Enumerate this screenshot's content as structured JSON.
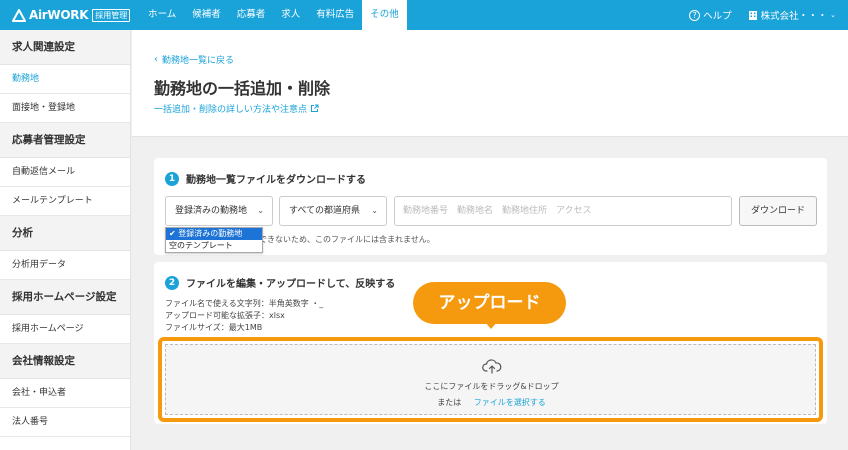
{
  "header": {
    "brand": "AirWORK",
    "badge": "採用管理",
    "nav": [
      "ホーム",
      "候補者",
      "応募者",
      "求人",
      "有料広告",
      "その他"
    ],
    "help": "ヘルプ",
    "company": "株式会社・・・",
    "accent": "#1aa3d9"
  },
  "sidebar": {
    "sec1_title": "求人関連設定",
    "sec1_items": [
      "勤務地",
      "面接地・登録地"
    ],
    "sec2_title": "応募者管理設定",
    "sec2_items": [
      "自動返信メール",
      "メールテンプレート"
    ],
    "sec3_title": "分析",
    "sec3_items": [
      "分析用データ"
    ],
    "sec4_title": "採用ホームページ設定",
    "sec4_items": [
      "採用ホームページ"
    ],
    "sec5_title": "会社情報設定",
    "sec5_items": [
      "会社・申込者",
      "法人番号"
    ]
  },
  "page": {
    "back": "勤務地一覧に戻る",
    "title": "勤務地の一括追加・削除",
    "detail": "一括追加・削除の詳しい方法や注意点"
  },
  "step1": {
    "num": "1",
    "title": "勤務地一覧ファイルをダウンロードする",
    "select1": "登録済みの勤務地",
    "select2": "すべての都道府県",
    "search_placeholder": "勤務地番号　勤務地名　勤務地住所　アクセス",
    "download": "ダウンロード",
    "note": "できないため、このファイルには含まれません。",
    "options": [
      "✔ 登録済みの勤務地",
      "空のテンプレート"
    ]
  },
  "step2": {
    "num": "2",
    "title": "ファイルを編集・アップロードして、反映する",
    "rule1": "ファイル名で使える文字列：半角英数字 ・_",
    "rule2": "アップロード可能な拡張子：xlsx",
    "rule3": "ファイルサイズ：最大1MB",
    "drop_text": "ここにファイルをドラッグ&ドロップ",
    "or": "または",
    "select_file": "ファイルを選択する"
  },
  "callout": {
    "label": "アップロード",
    "color": "#f59a0f"
  }
}
